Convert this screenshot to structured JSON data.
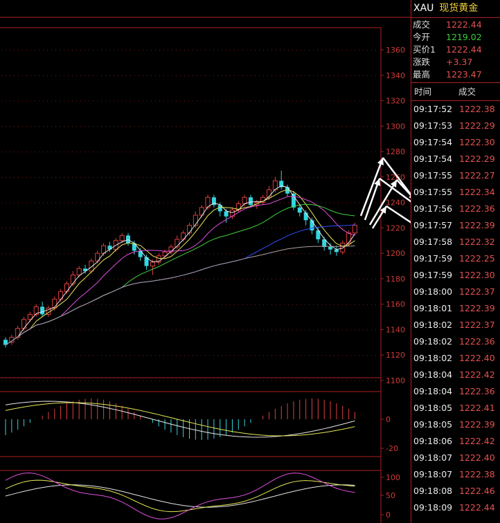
{
  "header": {
    "symbol": "XAU",
    "name": "现货黄金"
  },
  "quotes": [
    {
      "label": "成交",
      "value": "1222.44",
      "color": "#e25252"
    },
    {
      "label": "今开",
      "value": "1219.02",
      "color": "#3ccc3c"
    },
    {
      "label": "买价1",
      "value": "1222.44",
      "color": "#e25252"
    },
    {
      "label": "涨跌",
      "value": "+3.37",
      "color": "#e25252"
    },
    {
      "label": "最高",
      "value": "1223.47",
      "color": "#e25252"
    }
  ],
  "ticks_header": {
    "time": "时间",
    "price": "成交"
  },
  "ticks": [
    {
      "time": "09:17:52",
      "price": "1222.38"
    },
    {
      "time": "09:17:53",
      "price": "1222.29"
    },
    {
      "time": "09:17:54",
      "price": "1222.30"
    },
    {
      "time": "09:17:54",
      "price": "1222.29"
    },
    {
      "time": "09:17:55",
      "price": "1222.27"
    },
    {
      "time": "09:17:55",
      "price": "1222.34"
    },
    {
      "time": "09:17:56",
      "price": "1222.36"
    },
    {
      "time": "09:17:57",
      "price": "1222.39"
    },
    {
      "time": "09:17:58",
      "price": "1222.32"
    },
    {
      "time": "09:17:59",
      "price": "1222.25"
    },
    {
      "time": "09:17:59",
      "price": "1222.30"
    },
    {
      "time": "09:18:00",
      "price": "1222.37"
    },
    {
      "time": "09:18:01",
      "price": "1222.39"
    },
    {
      "time": "09:18:02",
      "price": "1222.37"
    },
    {
      "time": "09:18:02",
      "price": "1222.36"
    },
    {
      "time": "09:18:02",
      "price": "1222.40"
    },
    {
      "time": "09:18:04",
      "price": "1222.42"
    },
    {
      "time": "09:18:04",
      "price": "1222.36"
    },
    {
      "time": "09:18:05",
      "price": "1222.41"
    },
    {
      "time": "09:18:05",
      "price": "1222.39"
    },
    {
      "time": "09:18:06",
      "price": "1222.42"
    },
    {
      "time": "09:18:07",
      "price": "1222.40"
    },
    {
      "time": "09:18:07",
      "price": "1222.38"
    },
    {
      "time": "09:18:08",
      "price": "1222.46"
    },
    {
      "time": "09:18:09",
      "price": "1222.44"
    }
  ],
  "chart_data": {
    "type": "candlestick",
    "main": {
      "y_ticks": [
        "1360",
        "1340",
        "1320",
        "1300",
        "1280",
        "1260",
        "1240",
        "1220",
        "1200",
        "1180",
        "1160",
        "1140",
        "1120",
        "1100"
      ],
      "ylim": [
        1100,
        1360
      ],
      "candles": [
        [
          1132,
          1128,
          1134,
          1126
        ],
        [
          1130,
          1134,
          1136,
          1128
        ],
        [
          1134,
          1141,
          1143,
          1132
        ],
        [
          1141,
          1148,
          1150,
          1139
        ],
        [
          1148,
          1152,
          1154,
          1146
        ],
        [
          1152,
          1158,
          1160,
          1150
        ],
        [
          1158,
          1152,
          1162,
          1150
        ],
        [
          1152,
          1157,
          1159,
          1150
        ],
        [
          1157,
          1164,
          1166,
          1155
        ],
        [
          1164,
          1170,
          1172,
          1162
        ],
        [
          1170,
          1176,
          1178,
          1168
        ],
        [
          1176,
          1183,
          1186,
          1174
        ],
        [
          1183,
          1188,
          1190,
          1181
        ],
        [
          1188,
          1186,
          1191,
          1184
        ],
        [
          1186,
          1194,
          1196,
          1184
        ],
        [
          1194,
          1200,
          1202,
          1192
        ],
        [
          1200,
          1206,
          1208,
          1198
        ],
        [
          1206,
          1203,
          1209,
          1201
        ],
        [
          1203,
          1210,
          1212,
          1201
        ],
        [
          1210,
          1214,
          1216,
          1208
        ],
        [
          1214,
          1208,
          1216,
          1206
        ],
        [
          1208,
          1202,
          1210,
          1199
        ],
        [
          1202,
          1197,
          1204,
          1194
        ],
        [
          1197,
          1190,
          1199,
          1187
        ],
        [
          1190,
          1193,
          1195,
          1183
        ],
        [
          1193,
          1198,
          1200,
          1191
        ],
        [
          1198,
          1201,
          1203,
          1196
        ],
        [
          1201,
          1205,
          1207,
          1199
        ],
        [
          1205,
          1211,
          1214,
          1203
        ],
        [
          1211,
          1216,
          1218,
          1209
        ],
        [
          1216,
          1222,
          1224,
          1214
        ],
        [
          1222,
          1230,
          1233,
          1220
        ],
        [
          1230,
          1236,
          1238,
          1228
        ],
        [
          1236,
          1244,
          1246,
          1234
        ],
        [
          1244,
          1238,
          1246,
          1236
        ],
        [
          1238,
          1233,
          1240,
          1229
        ],
        [
          1233,
          1229,
          1235,
          1224
        ],
        [
          1229,
          1234,
          1236,
          1227
        ],
        [
          1234,
          1239,
          1241,
          1232
        ],
        [
          1239,
          1244,
          1246,
          1237
        ],
        [
          1244,
          1238,
          1246,
          1236
        ],
        [
          1238,
          1240,
          1242,
          1235
        ],
        [
          1240,
          1244,
          1246,
          1238
        ],
        [
          1244,
          1250,
          1253,
          1242
        ],
        [
          1250,
          1257,
          1260,
          1248
        ],
        [
          1257,
          1252,
          1265,
          1250
        ],
        [
          1252,
          1247,
          1254,
          1245
        ],
        [
          1247,
          1236,
          1249,
          1234
        ],
        [
          1236,
          1232,
          1238,
          1229
        ],
        [
          1232,
          1226,
          1234,
          1222
        ],
        [
          1226,
          1218,
          1228,
          1215
        ],
        [
          1218,
          1211,
          1220,
          1208
        ],
        [
          1211,
          1205,
          1213,
          1202
        ],
        [
          1205,
          1203,
          1208,
          1199
        ],
        [
          1203,
          1201,
          1206,
          1198
        ],
        [
          1201,
          1208,
          1210,
          1199
        ],
        [
          1208,
          1216,
          1218,
          1206
        ],
        [
          1216,
          1222,
          1224,
          1214
        ]
      ],
      "ma_lines": [
        {
          "color": "#e8e8e8"
        },
        {
          "color": "#e8e85a"
        },
        {
          "color": "#e050e0"
        },
        {
          "color": "#40d040"
        },
        {
          "color": "#3050ff"
        },
        {
          "color": "#b0a0a0"
        }
      ]
    },
    "macd": {
      "y_ticks": [
        "0",
        "-20"
      ]
    },
    "kdj": {
      "y_ticks": [
        "100",
        "50",
        "0"
      ]
    }
  }
}
